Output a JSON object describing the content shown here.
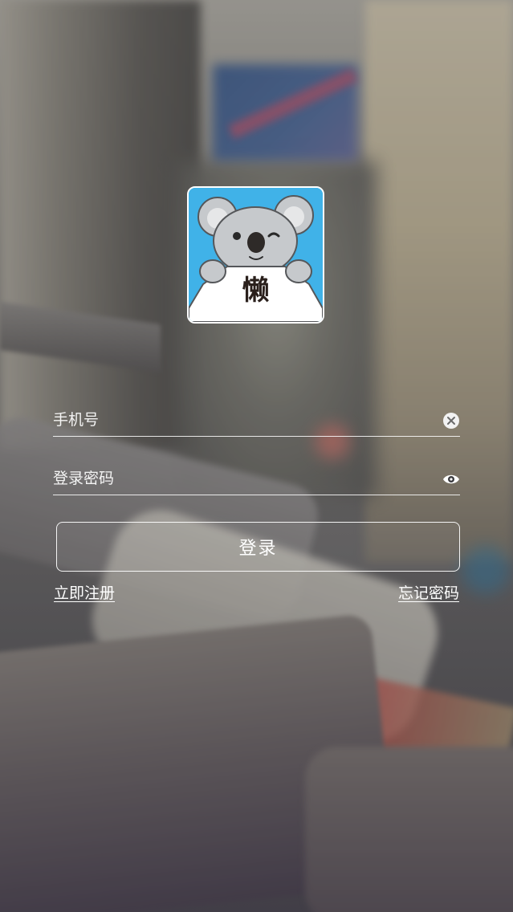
{
  "logo": {
    "text": "懒",
    "background_color": "#40b2e8",
    "icon": "koala-mascot-icon"
  },
  "login_form": {
    "phone_placeholder": "手机号",
    "phone_value": "",
    "phone_clear_icon": "clear-circle-icon",
    "password_placeholder": "登录密码",
    "password_value": "",
    "password_toggle_icon": "eye-icon",
    "login_label": "登录",
    "register_link": "立即注册",
    "forgot_link": "忘记密码"
  }
}
